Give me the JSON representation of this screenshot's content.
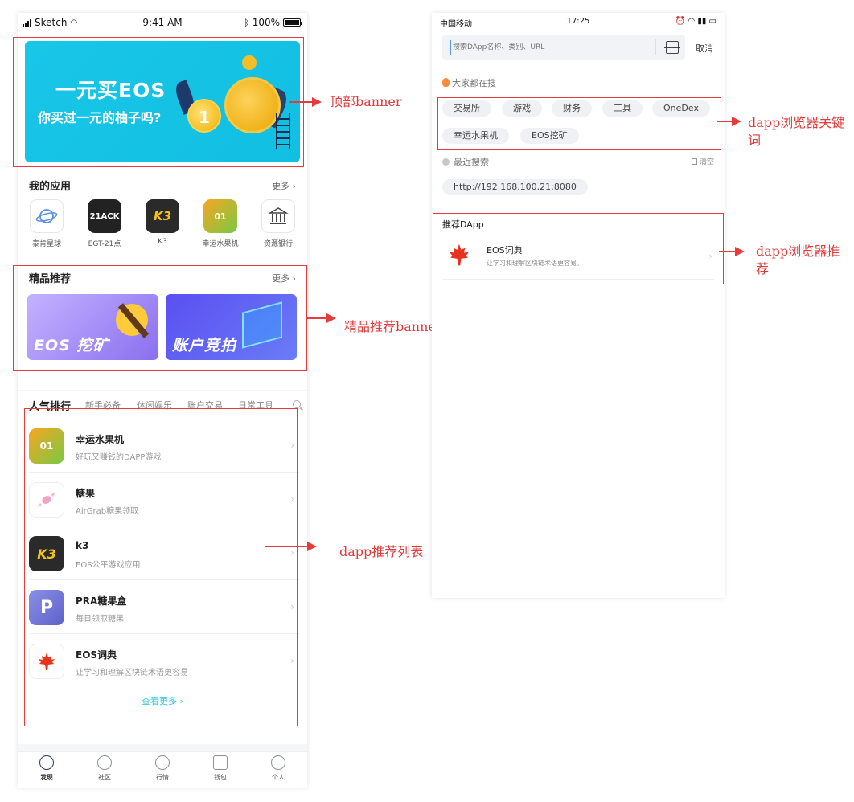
{
  "left_phone": {
    "status": {
      "carrier": "Sketch",
      "time": "9:41 AM",
      "battery": "100%"
    },
    "top_banner": {
      "title": "一元买EOS",
      "subtitle": "你买过一元的柚子吗?",
      "coin_label": "1"
    },
    "my_apps": {
      "title": "我的应用",
      "more": "更多 ›",
      "items": [
        {
          "label": "泰肯星球",
          "icon": "planet-icon"
        },
        {
          "label": "EGT-21点",
          "icon_text": "21ACK",
          "icon": "blackjack-icon"
        },
        {
          "label": "K3",
          "icon_text": "K3",
          "icon": "k3-icon"
        },
        {
          "label": "幸运水果机",
          "icon_text": "01",
          "icon": "fruit-machine-icon"
        },
        {
          "label": "资源银行",
          "icon": "bank-icon"
        }
      ]
    },
    "featured": {
      "title": "精品推荐",
      "more": "更多 ›",
      "banners": [
        {
          "label": "EOS 挖矿"
        },
        {
          "label": "账户竞拍"
        }
      ]
    },
    "ranking": {
      "tabs": [
        "人气排行",
        "新手必备",
        "休闲娱乐",
        "账户交易",
        "日常工具"
      ],
      "items": [
        {
          "name": "幸运水果机",
          "desc": "好玩又赚钱的DAPP游戏",
          "icon": "fruit-machine-icon",
          "icon_text": "01"
        },
        {
          "name": "糖果",
          "desc": "AirGrab糖果领取",
          "icon": "candy-icon"
        },
        {
          "name": "k3",
          "desc": "EOS公平游戏应用",
          "icon": "k3-icon",
          "icon_text": "K3"
        },
        {
          "name": "PRA糖果盒",
          "desc": "每日领取糖果",
          "icon": "pra-icon",
          "icon_text": "P"
        },
        {
          "name": "EOS词典",
          "desc": "让学习和理解区块链术语更容易",
          "icon": "maple-leaf-icon"
        }
      ],
      "view_more": "查看更多 ›"
    },
    "tabbar": [
      "发现",
      "社区",
      "行情",
      "钱包",
      "个人"
    ]
  },
  "right_phone": {
    "status": {
      "carrier": "中国移动",
      "time": "17:25"
    },
    "search_placeholder": "搜索DApp名称、类别、URL",
    "cancel": "取消",
    "hot_title": "大家都在搜",
    "hot_keywords": [
      "交易所",
      "游戏",
      "财务",
      "工具",
      "OneDex",
      "幸运水果机",
      "EOS挖矿"
    ],
    "recent_title": "最近搜索",
    "clear": "清空",
    "recent_items": [
      "http://192.168.100.21:8080"
    ],
    "recommend_title": "推荐DApp",
    "recommend": {
      "name": "EOS词典",
      "desc": "让学习和理解区块链术语更容易。"
    }
  },
  "annotations": {
    "top_banner": "顶部banner",
    "featured_banner": "精品推荐banner",
    "dapp_list": "dapp推荐列表",
    "browser_keywords": "dapp浏览器关键词",
    "browser_recommend": "dapp浏览器推荐"
  },
  "colors": {
    "accent": "#2ec5e6",
    "annotation": "#e73a3a",
    "banner": "#19c6e6"
  }
}
